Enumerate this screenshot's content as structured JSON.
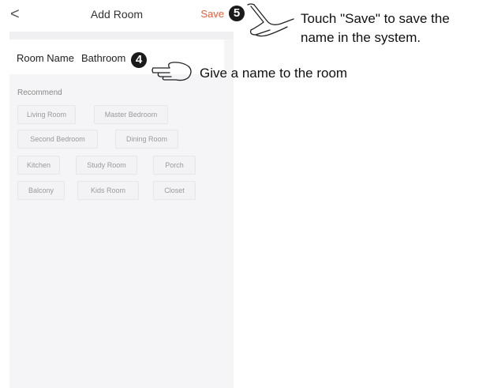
{
  "nav": {
    "back_glyph": "<",
    "title": "Add Room",
    "save_label": "Save"
  },
  "form": {
    "name_label": "Room Name",
    "name_value": "Bathroom"
  },
  "recommend": {
    "label": "Recommend",
    "chips": [
      "Living Room",
      "Master Bedroom",
      "Second Bedroom",
      "Dining Room",
      "Kitchen",
      "Study Room",
      "Porch",
      "Balcony",
      "Kids Room",
      "Closet"
    ]
  },
  "annotations": {
    "step4_number": "4",
    "step5_number": "5",
    "step4_text": "Give a name to the room",
    "step5_text_line1": "Touch \"Save\" to save the",
    "step5_text_line2": "name in the system."
  },
  "colors": {
    "accent": "#e8603c",
    "background": "#f5f5f7"
  }
}
